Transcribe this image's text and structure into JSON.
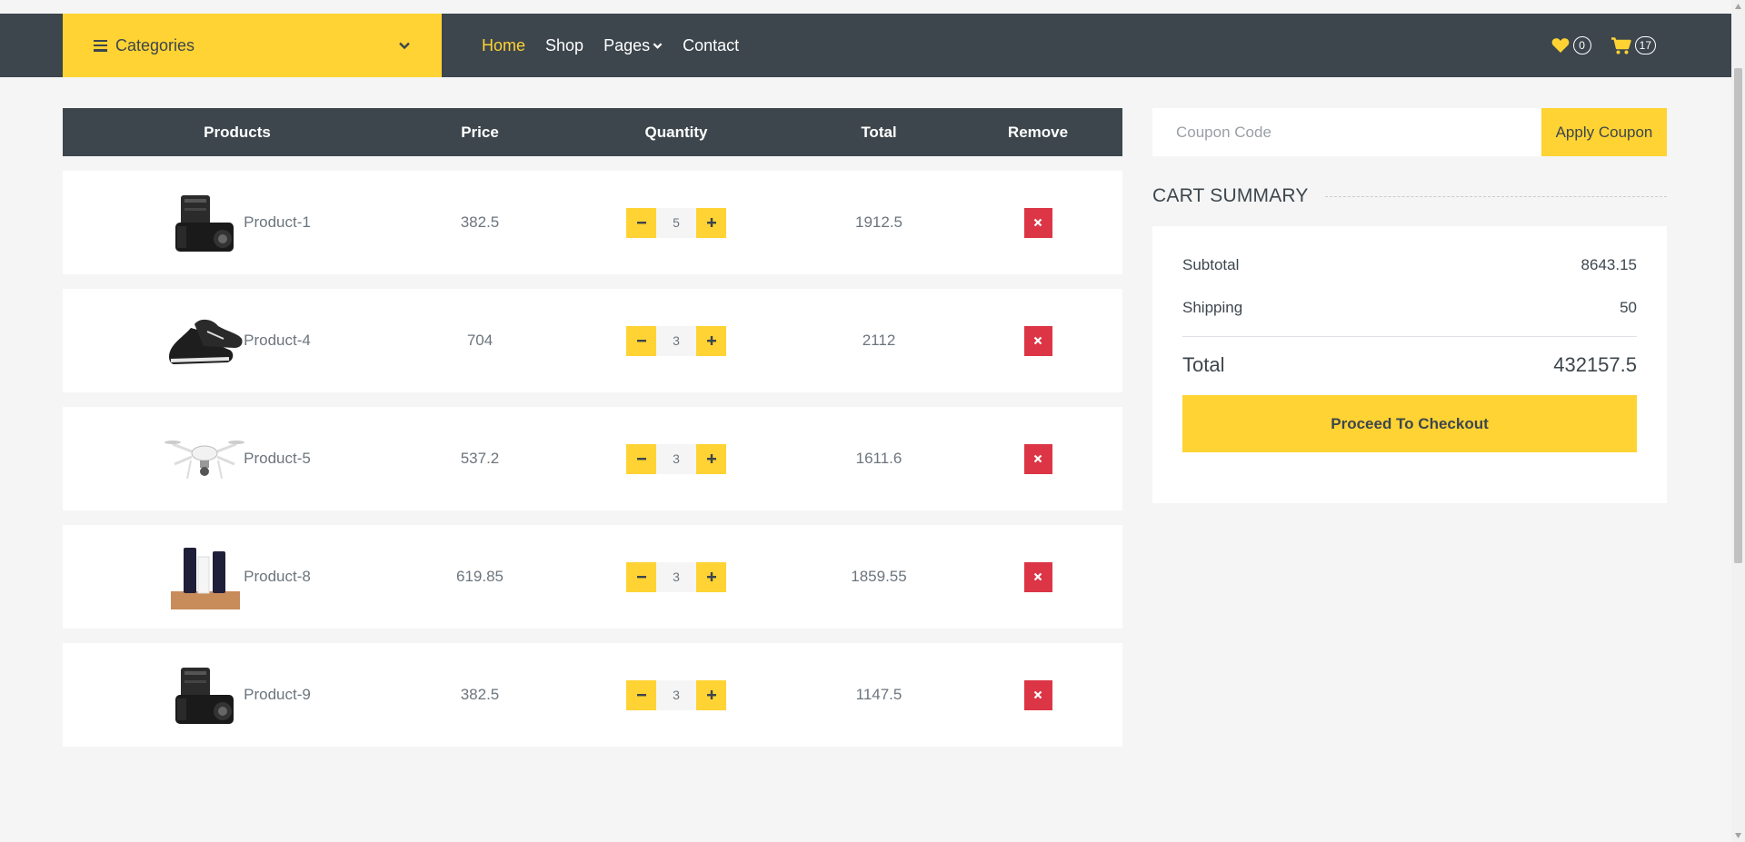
{
  "nav": {
    "categories_label": "Categories",
    "links": [
      {
        "label": "Home",
        "active": true
      },
      {
        "label": "Shop"
      },
      {
        "label": "Pages"
      },
      {
        "label": "Contact"
      }
    ],
    "wishlist_count": "0",
    "cart_count": "17"
  },
  "table": {
    "headers": [
      "Products",
      "Price",
      "Quantity",
      "Total",
      "Remove"
    ],
    "rows": [
      {
        "product": "Product-1",
        "image": "camera",
        "price": "382.5",
        "qty": "5",
        "total": "1912.5"
      },
      {
        "product": "Product-4",
        "image": "shoes",
        "price": "704",
        "qty": "3",
        "total": "2112"
      },
      {
        "product": "Product-5",
        "image": "drone",
        "price": "537.2",
        "qty": "3",
        "total": "1611.6"
      },
      {
        "product": "Product-8",
        "image": "cosmetics",
        "price": "619.85",
        "qty": "3",
        "total": "1859.55"
      },
      {
        "product": "Product-9",
        "image": "camera",
        "price": "382.5",
        "qty": "3",
        "total": "1147.5"
      }
    ]
  },
  "coupon": {
    "placeholder": "Coupon Code",
    "button": "Apply Coupon"
  },
  "summary": {
    "title": "CART SUMMARY",
    "subtotal_label": "Subtotal",
    "subtotal": "8643.15",
    "shipping_label": "Shipping",
    "shipping": "50",
    "total_label": "Total",
    "total": "432157.5",
    "checkout": "Proceed To Checkout"
  },
  "colors": {
    "accent": "#ffd333",
    "dark": "#3d464d",
    "danger": "#dc3545"
  }
}
